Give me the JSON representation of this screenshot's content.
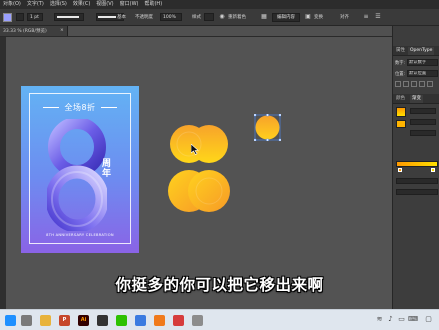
{
  "menubar": {
    "items": [
      "对象(O)",
      "文字(T)",
      "选择(S)",
      "效果(C)",
      "视图(V)",
      "窗口(W)",
      "帮助(H)"
    ]
  },
  "control_bar": {
    "stroke_weight": "1 pt",
    "stroke_label": "基本",
    "opacity_label": "不透明度",
    "opacity_value": "100%",
    "style_label": "样式",
    "align_label": "对齐",
    "global_edit_label": "重新着色",
    "edit_btn": "编辑内容",
    "align2_label": "变换",
    "transform_label": "对齐"
  },
  "document_tab": {
    "name": "33.33 % (RGB/预览)",
    "close": "×"
  },
  "artboard": {
    "title": "全场8折",
    "zhou_nian": "周年",
    "english": "8TH ANNIVERSARY CELEBRATION",
    "colors": {
      "bg_top": "#63b3f4",
      "bg_bottom": "#8a63e6",
      "eight": "#7067e8"
    }
  },
  "orange_object": {
    "colors": {
      "top": "#f9a12a",
      "bottom": "#ffd91f"
    }
  },
  "right_panel": {
    "tabs_top": [
      "属性",
      "OpenType"
    ],
    "row1_label": "数字:",
    "row1_value": "默认数字",
    "row2_label": "位置:",
    "row2_value": "默认位置",
    "tabs_mid": [
      "颜色",
      "渐变"
    ],
    "gradient_colors": {
      "start": "#ff9900",
      "end": "#ffe000"
    }
  },
  "subtitle": "你挺多的你可以把它移出来啊",
  "taskbar": {
    "apps": [
      {
        "name": "windows-start",
        "label": "",
        "color": "#1e90ff"
      },
      {
        "name": "search",
        "label": "",
        "color": "#7a7a7a"
      },
      {
        "name": "file-explorer",
        "label": "",
        "color": "#e8b33b"
      },
      {
        "name": "powerpoint",
        "label": "P",
        "color": "#c6462a"
      },
      {
        "name": "illustrator",
        "label": "Ai",
        "color": "#330000"
      },
      {
        "name": "app-dark",
        "label": "",
        "color": "#333333"
      },
      {
        "name": "wechat",
        "label": "",
        "color": "#2dc100"
      },
      {
        "name": "app-blue",
        "label": "",
        "color": "#3b7be0"
      },
      {
        "name": "app-orange",
        "label": "",
        "color": "#f07a1c"
      },
      {
        "name": "app-red",
        "label": "",
        "color": "#d63c3c"
      },
      {
        "name": "app-gray",
        "label": "",
        "color": "#8c8c8c"
      }
    ],
    "tray_icon_names": [
      "wifi-icon",
      "volume-icon",
      "battery-icon",
      "keyboard-icon"
    ],
    "notification_icon": "chat-bubble-icon"
  }
}
